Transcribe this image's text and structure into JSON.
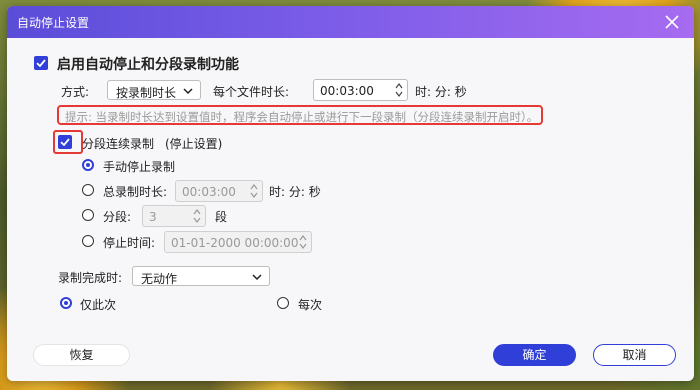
{
  "window": {
    "title": "自动停止设置"
  },
  "enable": {
    "label": "启用自动停止和分段录制功能",
    "checked": true
  },
  "method": {
    "label": "方式:",
    "selected": "按录制时长"
  },
  "per_file": {
    "label": "每个文件时长:",
    "value": "00:03:00",
    "unit": "时: 分: 秒"
  },
  "hint": "提示: 当录制时长达到设置值时，程序会自动停止或进行下一段录制（分段连续录制开启时）。",
  "segment": {
    "label": "分段连续录制",
    "sublabel": "(停止设置)",
    "checked": true
  },
  "options": {
    "manual": {
      "label": "手动停止录制",
      "selected": true
    },
    "total": {
      "label": "总录制时长:",
      "value": "00:03:00",
      "unit": "时: 分: 秒"
    },
    "count": {
      "label": "分段:",
      "value": "3",
      "unit": "段"
    },
    "stop_time": {
      "label": "停止时间:",
      "value": "01-01-2000 00:00:00"
    }
  },
  "after": {
    "label": "录制完成时:",
    "selected": "无动作"
  },
  "frequency": {
    "once": "仅此次",
    "every": "每次",
    "selected": "once"
  },
  "buttons": {
    "restore": "恢复",
    "ok": "确定",
    "cancel": "取消"
  },
  "colors": {
    "accent": "#2f3fd8",
    "highlight": "#e53935",
    "title_gradient_start": "#5a4dd8",
    "title_gradient_end": "#a66bf0"
  }
}
